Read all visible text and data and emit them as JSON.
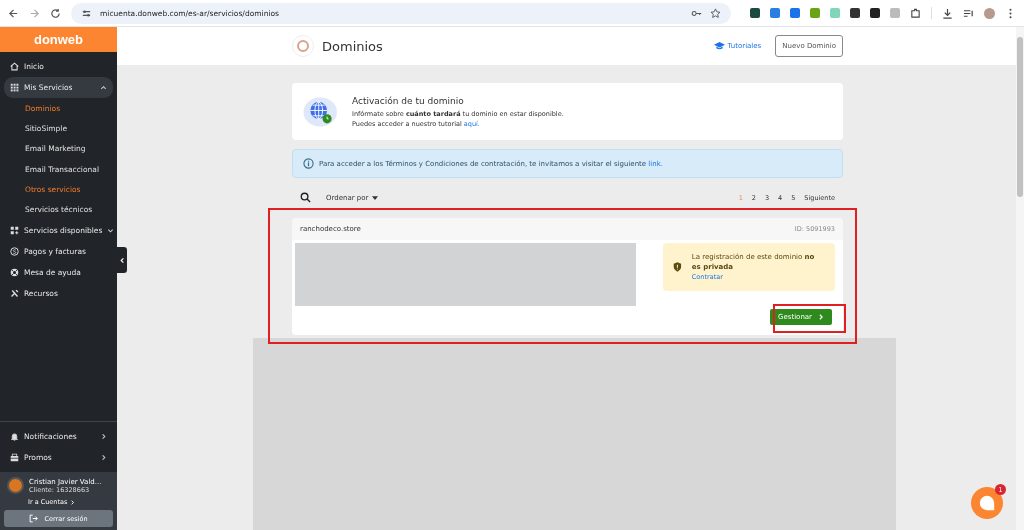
{
  "browser": {
    "url": "micuenta.donweb.com/es-ar/servicios/dominios"
  },
  "sidebar": {
    "logo": "donweb",
    "items": [
      {
        "label": "Inicio",
        "kind": "home",
        "expanded": false
      },
      {
        "label": "Mis Servicios",
        "kind": "grid",
        "expanded": true,
        "children": [
          {
            "label": "Dominios",
            "selected": true
          },
          {
            "label": "SitioSimple",
            "selected": false
          },
          {
            "label": "Email Marketing",
            "selected": false
          },
          {
            "label": "Email Transaccional",
            "selected": false
          },
          {
            "label": "Otros servicios",
            "selected": true
          },
          {
            "label": "Servicios técnicos",
            "selected": false
          }
        ]
      },
      {
        "label": "Servicios disponibles",
        "kind": "apps",
        "expanded": false
      },
      {
        "label": "Pagos y facturas",
        "kind": "dollar",
        "expanded": false
      },
      {
        "label": "Mesa de ayuda",
        "kind": "lifebuoy",
        "expanded": false
      },
      {
        "label": "Recursos",
        "kind": "tools",
        "expanded": false
      }
    ],
    "bottom_items": [
      {
        "label": "Notificaciones",
        "kind": "bell"
      },
      {
        "label": "Promos",
        "kind": "gift"
      }
    ],
    "user": {
      "name": "Cristian Javier Vald...",
      "client": "Cliente: 16328663",
      "link": "Ir a Cuentas"
    },
    "logout": "Cerrar sesión"
  },
  "header": {
    "title": "Dominios",
    "tutorials": "Tutoriales",
    "new_button": "Nuevo Dominio"
  },
  "activation_card": {
    "title": "Activación de tu dominio",
    "line_1": "Infórmate sobre **cuánto tardará** tu dominio en estar disponible.",
    "line_2": "Puedes acceder a nuestro tutorial",
    "link": "aquí."
  },
  "info_alert": {
    "text": "Para acceder a los Términos y Condiciones de contratación, te invitamos a visitar el siguiente",
    "link": "link."
  },
  "toolbar": {
    "sort": "Ordenar por",
    "pages": [
      {
        "label": "1",
        "selected": true
      },
      {
        "label": "2",
        "selected": false
      },
      {
        "label": "3",
        "selected": false
      },
      {
        "label": "4",
        "selected": false
      },
      {
        "label": "5",
        "selected": false
      }
    ],
    "next": "Siguiente"
  },
  "domain_card": {
    "domain": "ranchodeco.store",
    "id": "ID: 5091993",
    "privacy_text": "La registración de este dominio **no es privada**",
    "privacy_link": "Contratar",
    "manage_button": "Gestionar"
  },
  "chat": {
    "badge": "1"
  }
}
